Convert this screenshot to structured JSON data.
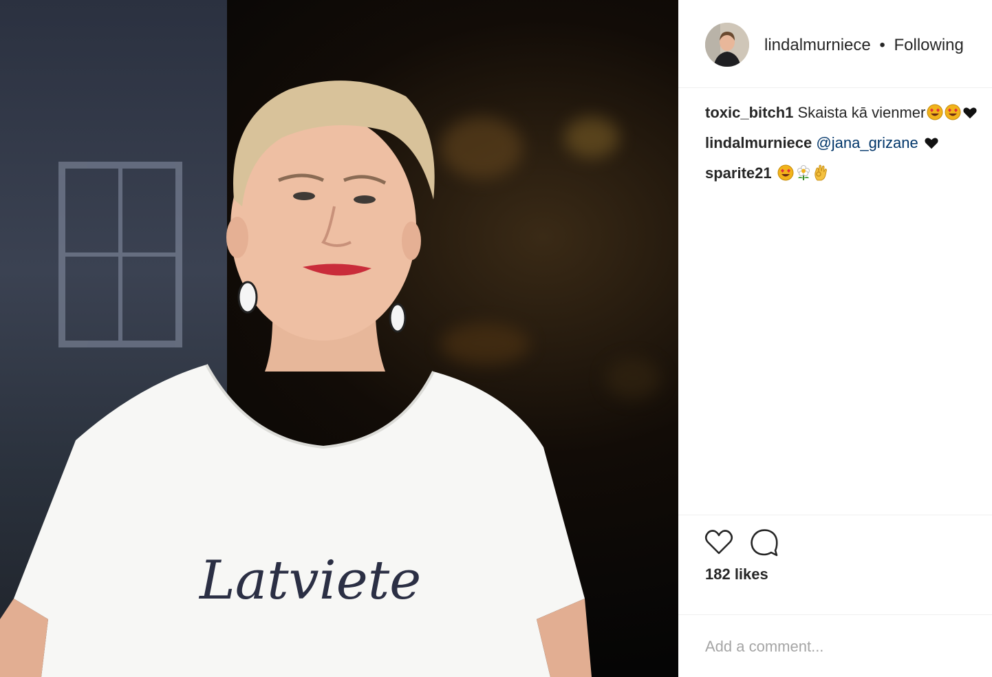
{
  "post": {
    "username": "lindalmurniece",
    "separator": "•",
    "follow_status": "Following"
  },
  "comments": [
    {
      "user": "toxic_bitch1",
      "text": "Skaista kā vienmer",
      "mention": "",
      "emojis": [
        "heart-eyes-emoji",
        "heart-eyes-emoji",
        "black-heart-emoji"
      ]
    },
    {
      "user": "lindalmurniece",
      "text": "",
      "mention": "@jana_grizane",
      "emojis": [
        "black-heart-emoji"
      ]
    },
    {
      "user": "sparite21",
      "text": "",
      "mention": "",
      "emojis": [
        "heart-eyes-emoji",
        "flower-emoji",
        "ok-hand-emoji"
      ]
    }
  ],
  "actions": {
    "icons": [
      "heart-icon",
      "comment-icon"
    ],
    "likes_text": "182 likes"
  },
  "add_comment": {
    "placeholder": "Add a comment..."
  },
  "photo": {
    "shirt_text": "Latviete"
  },
  "colors": {
    "text": "#262626",
    "mention": "#003569",
    "divider": "#efefef",
    "placeholder": "#a5a5a5"
  }
}
